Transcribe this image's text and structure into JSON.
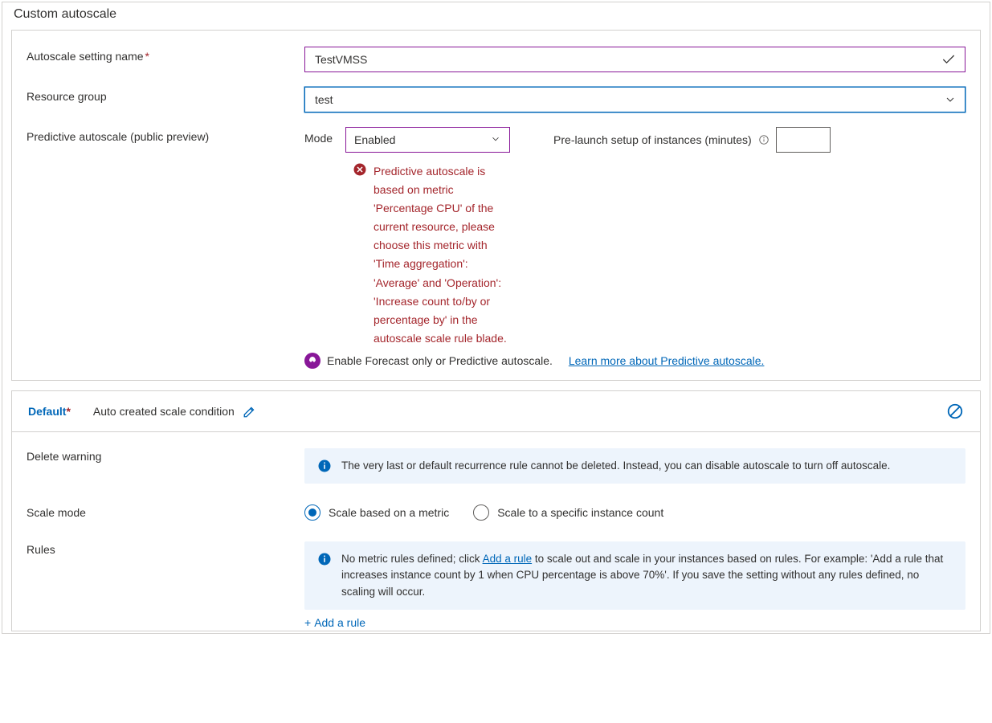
{
  "panelTitle": "Custom autoscale",
  "form": {
    "settingNameLabel": "Autoscale setting name",
    "settingNameValue": "TestVMSS",
    "resourceGroupLabel": "Resource group",
    "resourceGroupValue": "test",
    "predictiveLabel": "Predictive autoscale (public preview)",
    "modeLabel": "Mode",
    "modeValue": "Enabled",
    "prelaunchLabel": "Pre-launch setup of instances (minutes)",
    "errorText": "Predictive autoscale is based on metric 'Percentage CPU' of the current resource, please choose this metric with 'Time aggregation': 'Average' and 'Operation': 'Increase count to/by or percentage by' in the autoscale scale rule blade.",
    "forecastText": "Enable Forecast only or Predictive autoscale.",
    "forecastLink": "Learn more about Predictive autoscale."
  },
  "condition": {
    "defaultLabel": "Default",
    "subtitle": "Auto created scale condition",
    "deleteWarningLabel": "Delete warning",
    "deleteWarningText": "The very last or default recurrence rule cannot be deleted. Instead, you can disable autoscale to turn off autoscale.",
    "scaleModeLabel": "Scale mode",
    "radioMetric": "Scale based on a metric",
    "radioCount": "Scale to a specific instance count",
    "rulesLabel": "Rules",
    "rulesTextPre": "No metric rules defined; click ",
    "rulesAddRuleLink": "Add a rule",
    "rulesTextPost": " to scale out and scale in your instances based on rules. For example: 'Add a rule that increases instance count by 1 when CPU percentage is above 70%'. If you save the setting without any rules defined, no scaling will occur.",
    "addRule": "Add a rule"
  }
}
